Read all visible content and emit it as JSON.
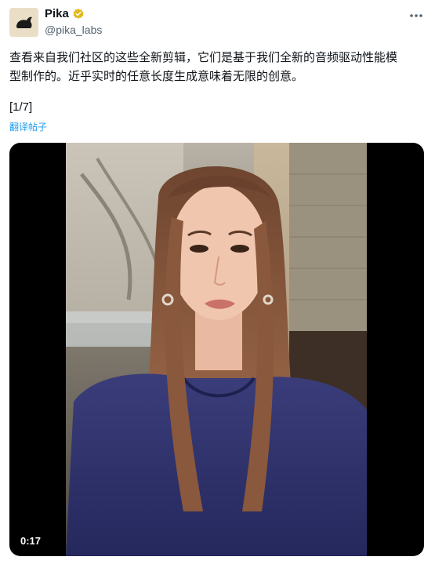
{
  "author": {
    "display_name": "Pika",
    "handle": "@pika_labs",
    "avatar_icon": "rabbit-logo-icon",
    "verified_icon": "verified-badge-icon",
    "verified_color": "#e2b719"
  },
  "menu": {
    "more_icon": "more-horizontal-icon"
  },
  "tweet": {
    "text": "查看来自我们社区的这些全新剪辑，它们是基于我们全新的音频驱动性能模\n型制作的。近乎实时的任意长度生成意味着无限的创意。",
    "counter": "[1/7]",
    "translate_label": "翻译帖子"
  },
  "media": {
    "type": "video",
    "duration": "0:17"
  },
  "colors": {
    "link": "#1d9bf0",
    "text": "#0f1419",
    "secondary": "#536471"
  }
}
